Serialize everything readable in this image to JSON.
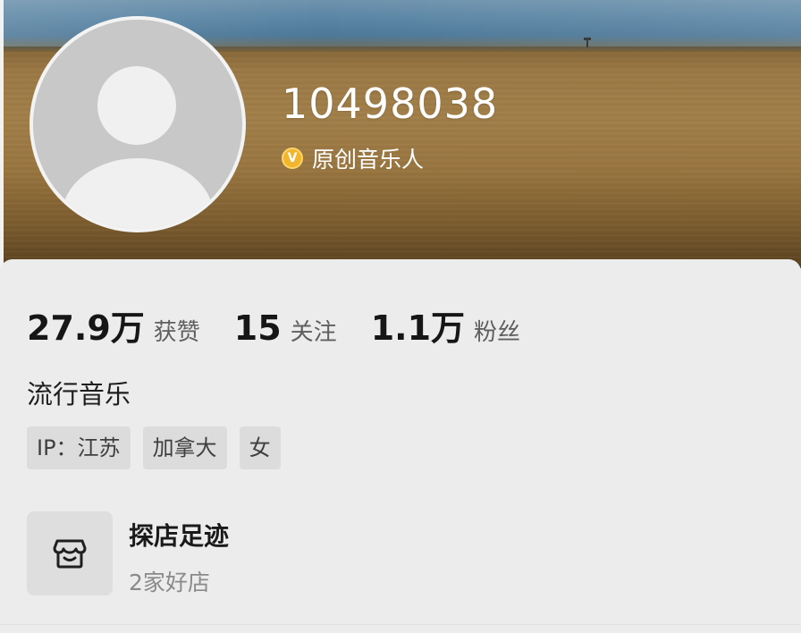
{
  "profile": {
    "user_id": "10498038",
    "badge_icon": "v-badge-icon",
    "badge_label": "原创音乐人",
    "badge_color": "#f2b52b"
  },
  "stats": [
    {
      "value": "27.9万",
      "label": "获赞"
    },
    {
      "value": "15",
      "label": "关注"
    },
    {
      "value": "1.1万",
      "label": "粉丝"
    }
  ],
  "bio": "流行音乐",
  "tags": [
    "IP：江苏",
    "加拿大",
    "女"
  ],
  "shop": {
    "icon": "shop-icon",
    "title": "探店足迹",
    "subtitle": "2家好店"
  }
}
